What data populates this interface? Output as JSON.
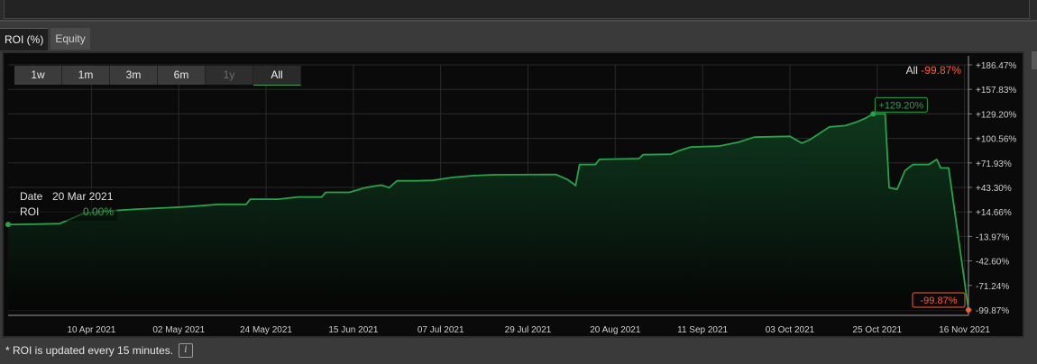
{
  "tabs": [
    {
      "label": "ROI (%)",
      "active": true
    },
    {
      "label": "Equity",
      "active": false
    }
  ],
  "range_buttons": [
    {
      "label": "1w",
      "state": "normal"
    },
    {
      "label": "1m",
      "state": "normal"
    },
    {
      "label": "3m",
      "state": "normal"
    },
    {
      "label": "6m",
      "state": "normal"
    },
    {
      "label": "1y",
      "state": "disabled"
    },
    {
      "label": "All",
      "state": "active"
    }
  ],
  "summary": {
    "label": "All",
    "value": "-99.87%"
  },
  "tooltip": {
    "date_label": "Date",
    "date_value": "20 Mar 2021",
    "roi_label": "ROI",
    "roi_value": "0.00%"
  },
  "footnote": "* ROI is updated every 15 minutes.",
  "info_icon": "i",
  "colors": {
    "line": "#23a44a",
    "fill_top": "#0f3a1e",
    "negative": "#ff5a36",
    "grid": "#2a2a2a"
  },
  "chart_data": {
    "type": "area",
    "x_ticks": [
      "10 Apr 2021",
      "02 May 2021",
      "24 May 2021",
      "15 Jun 2021",
      "07 Jul 2021",
      "29 Jul 2021",
      "20 Aug 2021",
      "11 Sep 2021",
      "03 Oct 2021",
      "25 Oct 2021",
      "16 Nov 2021"
    ],
    "y_ticks": [
      "+186.47%",
      "+157.83%",
      "+129.20%",
      "+100.56%",
      "+71.93%",
      "+43.30%",
      "+14.66%",
      "-13.97%",
      "-42.60%",
      "-71.24%",
      "-99.87%"
    ],
    "ylim": [
      -99.87,
      186.47
    ],
    "xlim": [
      "2021-03-20",
      "2021-11-17"
    ],
    "grid": true,
    "annotations": [
      {
        "date": "2021-10-24",
        "value": 129.2,
        "label": "+129.20%",
        "style": "positive"
      },
      {
        "date": "2021-11-17",
        "value": -99.87,
        "label": "-99.87%",
        "style": "negative"
      }
    ],
    "series": [
      {
        "points": [
          [
            "2021-03-20",
            0.0
          ],
          [
            "2021-03-22",
            0.0
          ],
          [
            "2021-03-28",
            0.5
          ],
          [
            "2021-04-02",
            1.0
          ],
          [
            "2021-04-05",
            7.0
          ],
          [
            "2021-04-08",
            13.0
          ],
          [
            "2021-04-15",
            16.0
          ],
          [
            "2021-04-22",
            18.0
          ],
          [
            "2021-04-29",
            19.5
          ],
          [
            "2021-05-05",
            21.0
          ],
          [
            "2021-05-12",
            23.5
          ],
          [
            "2021-05-19",
            23.5
          ],
          [
            "2021-05-20",
            29.5
          ],
          [
            "2021-05-27",
            29.5
          ],
          [
            "2021-06-01",
            32.0
          ],
          [
            "2021-06-07",
            32.0
          ],
          [
            "2021-06-08",
            37.5
          ],
          [
            "2021-06-14",
            37.5
          ],
          [
            "2021-06-18",
            43.0
          ],
          [
            "2021-06-22",
            46.0
          ],
          [
            "2021-06-24",
            43.0
          ],
          [
            "2021-06-26",
            51.0
          ],
          [
            "2021-07-01",
            51.0
          ],
          [
            "2021-07-05",
            51.5
          ],
          [
            "2021-07-10",
            55.0
          ],
          [
            "2021-07-15",
            57.0
          ],
          [
            "2021-07-20",
            58.0
          ],
          [
            "2021-08-05",
            58.5
          ],
          [
            "2021-08-08",
            52.5
          ],
          [
            "2021-08-10",
            45.5
          ],
          [
            "2021-08-11",
            70.0
          ],
          [
            "2021-08-15",
            70.0
          ],
          [
            "2021-08-16",
            76.0
          ],
          [
            "2021-08-26",
            77.0
          ],
          [
            "2021-08-27",
            81.5
          ],
          [
            "2021-09-03",
            82.0
          ],
          [
            "2021-09-05",
            86.0
          ],
          [
            "2021-09-08",
            90.5
          ],
          [
            "2021-09-15",
            91.5
          ],
          [
            "2021-09-20",
            96.0
          ],
          [
            "2021-09-24",
            102.0
          ],
          [
            "2021-10-03",
            103.0
          ],
          [
            "2021-10-06",
            95.0
          ],
          [
            "2021-10-08",
            99.0
          ],
          [
            "2021-10-11",
            108.0
          ],
          [
            "2021-10-13",
            114.0
          ],
          [
            "2021-10-17",
            115.5
          ],
          [
            "2021-10-20",
            120.0
          ],
          [
            "2021-10-22",
            124.0
          ],
          [
            "2021-10-24",
            129.2
          ],
          [
            "2021-10-27",
            129.2
          ],
          [
            "2021-10-28",
            43.0
          ],
          [
            "2021-10-30",
            41.0
          ],
          [
            "2021-11-01",
            63.0
          ],
          [
            "2021-11-03",
            70.0
          ],
          [
            "2021-11-07",
            70.0
          ],
          [
            "2021-11-09",
            76.0
          ],
          [
            "2021-11-10",
            66.0
          ],
          [
            "2021-11-12",
            66.0
          ],
          [
            "2021-11-17",
            -99.87
          ]
        ]
      }
    ]
  }
}
